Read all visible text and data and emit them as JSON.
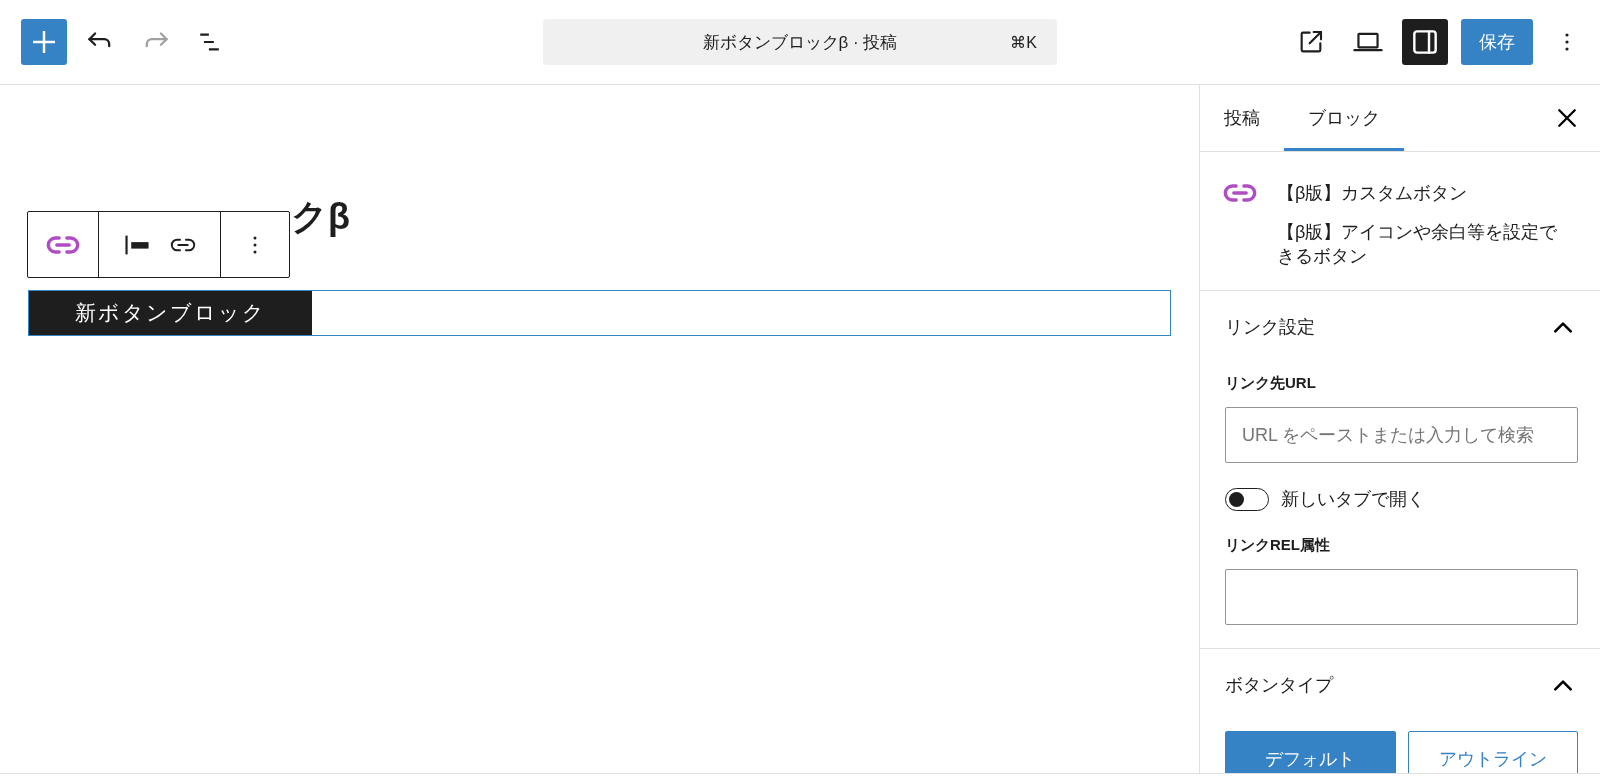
{
  "top_bar": {
    "undo": {
      "disabled": false
    },
    "redo": {
      "disabled": true
    },
    "command_center": {
      "title": "新ボタンブロックβ · 投稿",
      "shortcut": "⌘K"
    },
    "sidebar_toggle": {
      "pressed": true
    },
    "save_button": {
      "label": "保存"
    }
  },
  "editor": {
    "post_title": "クβ",
    "button_block": {
      "label": "新ボタンブロック",
      "selected": true
    }
  },
  "sidebar": {
    "tabs": [
      {
        "label": "投稿",
        "selected": false
      },
      {
        "label": "ブロック",
        "selected": true
      }
    ],
    "block_card": {
      "title": "【β版】カスタムボタン",
      "description": "【β版】アイコンや余白等を設定できるボタン"
    },
    "panels": [
      {
        "title": "リンク設定",
        "expanded": true,
        "fields": [
          {
            "kind": "text",
            "label": "リンク先URL",
            "placeholder": "URL をペーストまたは入力して検索"
          },
          {
            "kind": "toggle",
            "label": "新しいタブで開く",
            "on": false
          },
          {
            "kind": "text",
            "label": "リンクREL属性"
          }
        ]
      },
      {
        "title": "ボタンタイプ",
        "expanded": true,
        "options": [
          {
            "label": "デフォルト",
            "selected": true
          },
          {
            "label": "アウトライン",
            "selected": false
          }
        ]
      }
    ]
  }
}
